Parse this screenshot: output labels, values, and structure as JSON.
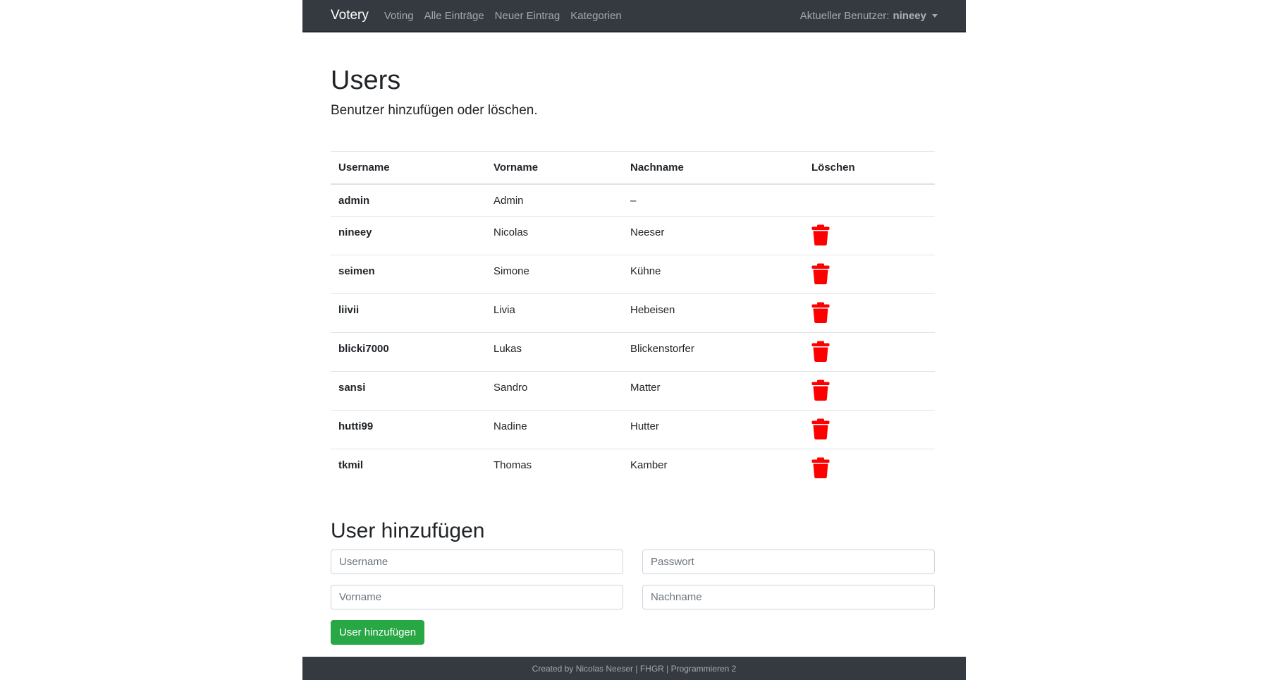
{
  "colors": {
    "navbar_bg": "#343a40",
    "delete_icon": "#ff0000",
    "add_button": "#28a745"
  },
  "navbar": {
    "brand": "Votery",
    "links": [
      "Voting",
      "Alle Einträge",
      "Neuer Eintrag",
      "Kategorien"
    ],
    "user_label": "Aktueller Benutzer:",
    "user_name": "nineey",
    "user_menu_icon": "caret-down-icon"
  },
  "main": {
    "title": "Users",
    "lead": "Benutzer hinzufügen oder löschen."
  },
  "table": {
    "headers": [
      "Username",
      "Vorname",
      "Nachname",
      "Löschen"
    ],
    "delete_icon": "trash-icon",
    "rows": [
      {
        "username": "admin",
        "vorname": "Admin",
        "nachname": "–",
        "deletable": false
      },
      {
        "username": "nineey",
        "vorname": "Nicolas",
        "nachname": "Neeser",
        "deletable": true
      },
      {
        "username": "seimen",
        "vorname": "Simone",
        "nachname": "Kühne",
        "deletable": true
      },
      {
        "username": "liivii",
        "vorname": "Livia",
        "nachname": "Hebeisen",
        "deletable": true
      },
      {
        "username": "blicki7000",
        "vorname": "Lukas",
        "nachname": "Blickenstorfer",
        "deletable": true
      },
      {
        "username": "sansi",
        "vorname": "Sandro",
        "nachname": "Matter",
        "deletable": true
      },
      {
        "username": "hutti99",
        "vorname": "Nadine",
        "nachname": "Hutter",
        "deletable": true
      },
      {
        "username": "tkmil",
        "vorname": "Thomas",
        "nachname": "Kamber",
        "deletable": true
      }
    ]
  },
  "form": {
    "title": "User hinzufügen",
    "username_placeholder": "Username",
    "username_value": "",
    "password_placeholder": "Passwort",
    "password_value": "",
    "vorname_placeholder": "Vorname",
    "vorname_value": "",
    "nachname_placeholder": "Nachname",
    "nachname_value": "",
    "submit_label": "User hinzufügen"
  },
  "footer": {
    "text": "Created by Nicolas Neeser | FHGR | Programmieren 2"
  }
}
